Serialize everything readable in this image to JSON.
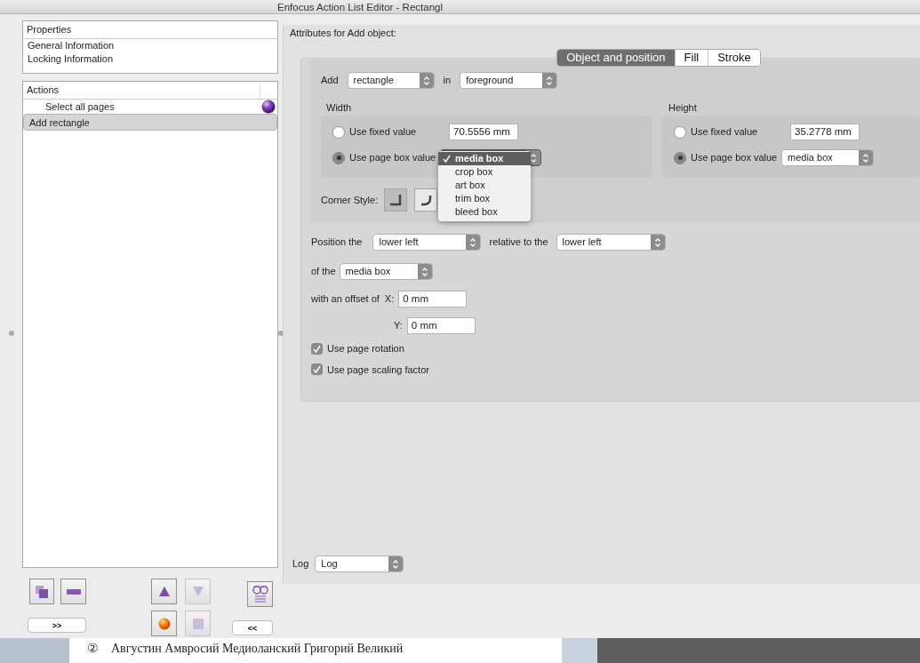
{
  "window": {
    "title": "Enfocus Action List Editor - Rectangl"
  },
  "properties": {
    "header": "Properties",
    "items": [
      "General Information",
      "Locking Information"
    ]
  },
  "actions": {
    "header": "Actions",
    "items": [
      {
        "label": "Select all pages",
        "selected": false,
        "kind": "ball"
      },
      {
        "label": "Add rectangle",
        "selected": true,
        "kind": "plain"
      }
    ]
  },
  "tool_buttons": [
    {
      "kind": "duplicate",
      "disabled": false
    },
    {
      "kind": "remove",
      "disabled": false
    },
    {
      "kind": "move-up",
      "disabled": false
    },
    {
      "kind": "move-down",
      "disabled": true
    },
    {
      "kind": "preview",
      "disabled": false
    },
    {
      "kind": "expand",
      "label": ">>",
      "disabled": false
    },
    {
      "kind": "run",
      "disabled": false
    },
    {
      "kind": "stop",
      "disabled": true
    },
    {
      "kind": "collapse",
      "label": "<<",
      "disabled": false
    }
  ],
  "attributes": {
    "title": "Attributes for Add object:",
    "tabs": [
      {
        "label": "Object and position",
        "selected": true
      },
      {
        "label": "Fill",
        "selected": false
      },
      {
        "label": "Stroke",
        "selected": false
      }
    ],
    "add": {
      "label": "Add",
      "object": "rectangle",
      "in_label": "in",
      "layer": "foreground"
    },
    "width": {
      "title": "Width",
      "options": [
        {
          "label": "Use fixed value",
          "selected": false
        },
        {
          "label": "Use page box value",
          "selected": true
        }
      ],
      "fixed_value": "70.5556 mm"
    },
    "height": {
      "title": "Height",
      "options": [
        {
          "label": "Use fixed value",
          "selected": false
        },
        {
          "label": "Use page box value",
          "selected": true
        }
      ],
      "fixed_value": "35.2778 mm",
      "box_value": "media box"
    },
    "corner_style": {
      "label": "Corner Style:",
      "options": [
        {
          "kind": "square",
          "selected": true
        },
        {
          "kind": "round",
          "selected": false
        }
      ]
    },
    "box_menu": [
      {
        "label": "media box",
        "selected": true
      },
      {
        "label": "crop box",
        "selected": false
      },
      {
        "label": "art box",
        "selected": false
      },
      {
        "label": "trim box",
        "selected": false
      },
      {
        "label": "bleed box",
        "selected": false
      }
    ],
    "position": {
      "label": "Position the",
      "anchor": "lower left",
      "relative_label": "relative to the",
      "target": "lower left",
      "of_label": "of the",
      "box": "media box"
    },
    "offset": {
      "label": "with an offset of",
      "x_label": "X:",
      "x": "0 mm",
      "y_label": "Y:",
      "y": "0 mm"
    },
    "checkboxes": [
      {
        "label": "Use page rotation",
        "checked": true
      },
      {
        "label": "Use page scaling factor",
        "checked": true
      }
    ],
    "log": {
      "label": "Log",
      "value": "Log"
    }
  },
  "background_document": {
    "marker": "②",
    "text": "Августин  Амвросий  Медиоланский  Григорий  Великий"
  }
}
